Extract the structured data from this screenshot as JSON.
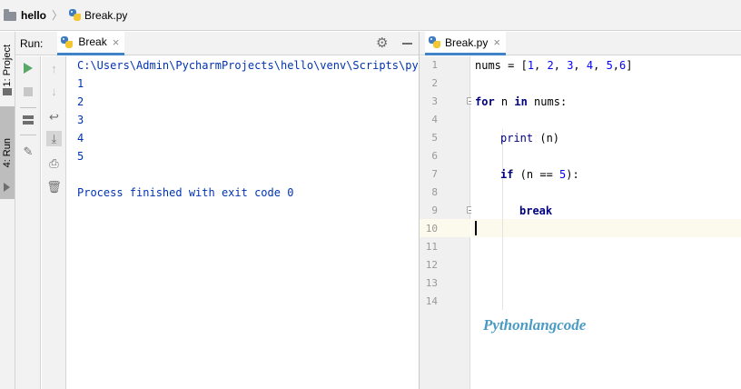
{
  "navbar": {
    "project": "hello",
    "separator": "〉",
    "file": "Break.py"
  },
  "stripe": {
    "project_tab": "1: Project",
    "run_tab": "4: Run"
  },
  "run_panel": {
    "title": "Run:",
    "tab_label": "Break",
    "close_glyph": "×",
    "gear_glyph": "⚙",
    "console_lines": [
      "C:\\Users\\Admin\\PycharmProjects\\hello\\venv\\Scripts\\pyth",
      "1",
      "2",
      "3",
      "4",
      "5",
      "",
      "Process finished with exit code 0"
    ]
  },
  "toolbar2_glyphs": {
    "up": "↑",
    "down": "↓",
    "wrap": "↩",
    "scroll_end": "⤓",
    "print": "⎙",
    "trash": "🗑"
  },
  "editor": {
    "tab_label": "Break.py",
    "close_glyph": "×",
    "line_numbers": [
      "1",
      "2",
      "3",
      "4",
      "5",
      "6",
      "7",
      "8",
      "9",
      "10",
      "11",
      "12",
      "13",
      "14"
    ],
    "current_line": "10",
    "code": {
      "l1_ident": "nums",
      "l1_eq": " = [",
      "l1_nums": [
        "1",
        "2",
        "3",
        "4",
        "5",
        "6"
      ],
      "l1_close": "]",
      "l3_for": "for",
      "l3_mid": " n ",
      "l3_in": "in",
      "l3_rest": " nums:",
      "l5_print": "print",
      "l5_rest": " (n)",
      "l7_if": "if",
      "l7_open": " (n == ",
      "l7_num": "5",
      "l7_close": "):",
      "l9_break": "break"
    }
  },
  "watermark": "Pythonlangcode"
}
